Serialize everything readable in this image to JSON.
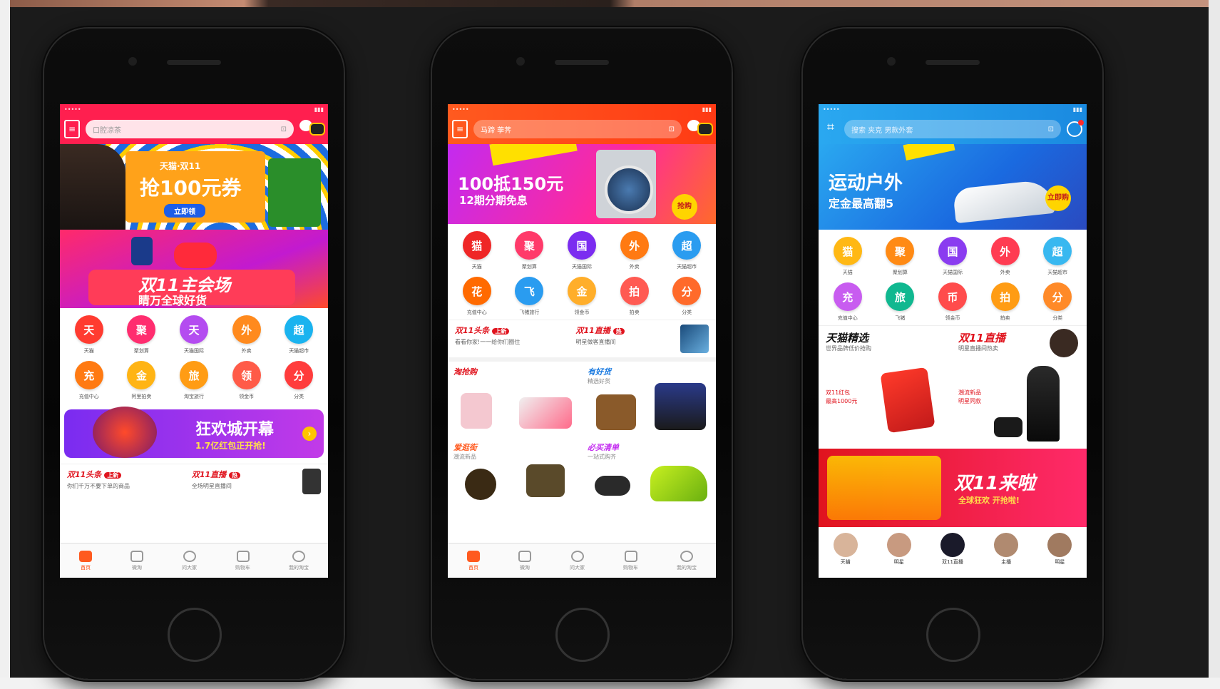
{
  "phones": [
    {
      "theme": "#ff1f4f",
      "search": {
        "placeholder": "口腔凉茶"
      },
      "banner_top": {
        "main": "抢100元券",
        "sub": "天猫·双11",
        "button": "立即领"
      },
      "banner_main": {
        "title": "双11主会场",
        "sub": "睛万全球好货"
      },
      "icons": [
        {
          "glyph": "天",
          "label": "天猫",
          "color": "#ff3b30"
        },
        {
          "glyph": "聚",
          "label": "聚划算",
          "color": "#ff2d6f"
        },
        {
          "glyph": "天",
          "label": "天猫国际",
          "color": "#b44cf0"
        },
        {
          "glyph": "外",
          "label": "外卖",
          "color": "#ff8a1e"
        },
        {
          "glyph": "超",
          "label": "天猫超市",
          "color": "#1ab3ef"
        },
        {
          "glyph": "充",
          "label": "充值中心",
          "color": "#ff7a12"
        },
        {
          "glyph": "金",
          "label": "阿里拍卖",
          "color": "#ffb414"
        },
        {
          "glyph": "旅",
          "label": "淘宝旅行",
          "color": "#ff9c14"
        },
        {
          "glyph": "领",
          "label": "领金币",
          "color": "#ff5b48"
        },
        {
          "glyph": "分",
          "label": "分类",
          "color": "#ff3c3c"
        }
      ],
      "carnival": {
        "title": "狂欢城开幕",
        "sub": "1.7亿红包正开抢!"
      },
      "headlines": [
        {
          "title": "双11头条",
          "badge": "上新",
          "sub": "你们千万不要下单的商品"
        },
        {
          "title": "双11直播",
          "badge": "热",
          "sub": "全场明星直播间"
        }
      ],
      "tabs": [
        "首页",
        "微淘",
        "问大家",
        "购物车",
        "我的淘宝"
      ]
    },
    {
      "theme": "#ff5a1f",
      "search": {
        "placeholder": "马蹄 荸荠"
      },
      "banner_top": {
        "main": "100抵150元",
        "sub": "12期分期免息",
        "badge": "抢购"
      },
      "icons": [
        {
          "glyph": "猫",
          "label": "天猫",
          "color": "#ef2626"
        },
        {
          "glyph": "聚",
          "label": "聚划算",
          "color": "#ff3a6a"
        },
        {
          "glyph": "国",
          "label": "天猫国际",
          "color": "#7b2cf0"
        },
        {
          "glyph": "外",
          "label": "外卖",
          "color": "#ff7a12"
        },
        {
          "glyph": "超",
          "label": "天猫超市",
          "color": "#2a9cf0"
        },
        {
          "glyph": "花",
          "label": "充值中心",
          "color": "#ff6a00"
        },
        {
          "glyph": "飞",
          "label": "飞猪旅行",
          "color": "#2a9cf0"
        },
        {
          "glyph": "金",
          "label": "领金币",
          "color": "#ffae2a"
        },
        {
          "glyph": "拍",
          "label": "拍卖",
          "color": "#ff5a52"
        },
        {
          "glyph": "分",
          "label": "分类",
          "color": "#ff6a2a"
        }
      ],
      "headlines": [
        {
          "title": "双11头条",
          "badge": "上新",
          "sub": "看看你家!一一给你们圈住"
        },
        {
          "title": "双11直播",
          "badge": "热",
          "sub": "明星做客直播间"
        }
      ],
      "sections": [
        {
          "title": "淘抢购"
        },
        {
          "title": "有好货",
          "sub": "精选好货"
        },
        {
          "title": "爱逛街",
          "sub": "潮流新品"
        },
        {
          "title": "必买清单",
          "sub": "一站式购齐"
        }
      ],
      "tabs": [
        "首页",
        "微淘",
        "问大家",
        "购物车",
        "我的淘宝"
      ]
    },
    {
      "theme": "#19a0f0",
      "search": {
        "placeholder": "搜索 夹克 男款外套"
      },
      "banner_top": {
        "main": "运动户外",
        "sub": "定金最高翻5",
        "badge": "立即购"
      },
      "icons": [
        {
          "glyph": "猫",
          "label": "天猫",
          "color": "#ffb814"
        },
        {
          "glyph": "聚",
          "label": "聚划算",
          "color": "#ff8a14"
        },
        {
          "glyph": "国",
          "label": "天猫国际",
          "color": "#8a3cf0"
        },
        {
          "glyph": "外",
          "label": "外卖",
          "color": "#ff3c52"
        },
        {
          "glyph": "超",
          "label": "天猫超市",
          "color": "#38b8f0"
        },
        {
          "glyph": "充",
          "label": "充值中心",
          "color": "#c85cf0"
        },
        {
          "glyph": "旅",
          "label": "飞猪",
          "color": "#10b890"
        },
        {
          "glyph": "币",
          "label": "领金币",
          "color": "#ff4c4c"
        },
        {
          "glyph": "拍",
          "label": "拍卖",
          "color": "#ff9c14"
        },
        {
          "glyph": "分",
          "label": "分类",
          "color": "#ff8a28"
        }
      ],
      "headlines": [
        {
          "title": "天猫精选",
          "sub": "世界品牌低价抢购"
        },
        {
          "title": "双11直播",
          "sub": "明星直播间热卖"
        }
      ],
      "promo_mid": [
        {
          "title": "双11红包",
          "sub": "最高1000元"
        },
        {
          "title": "潮流新品",
          "sub": "明星同款"
        }
      ],
      "bottom_banner": {
        "title": "双11来啦",
        "sub": "全球狂欢 开抢啦!"
      },
      "people": [
        "天猫",
        "明星",
        "双11直播",
        "主播",
        "明星"
      ]
    }
  ]
}
